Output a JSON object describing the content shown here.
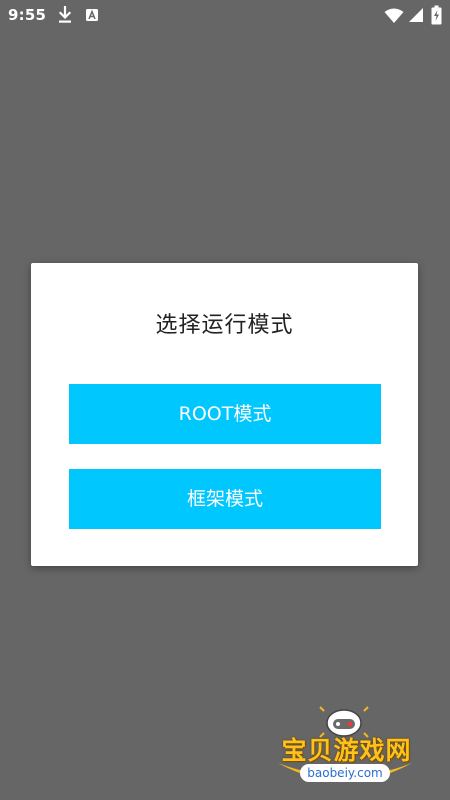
{
  "status_bar": {
    "time": "9:55",
    "icons": [
      "download-icon",
      "a-icon",
      "wifi-icon",
      "signal-icon",
      "battery-icon"
    ]
  },
  "dialog": {
    "title": "选择运行模式",
    "buttons": [
      {
        "label": "ROOT模式"
      },
      {
        "label": "框架模式"
      }
    ]
  },
  "watermark": {
    "text": "宝贝游戏网",
    "domain": "baobeiy.com"
  },
  "colors": {
    "background_overlay": "#666666",
    "button_accent": "#00C8FF",
    "dialog_bg": "#FFFFFF",
    "watermark_text": "#FFC21A"
  }
}
